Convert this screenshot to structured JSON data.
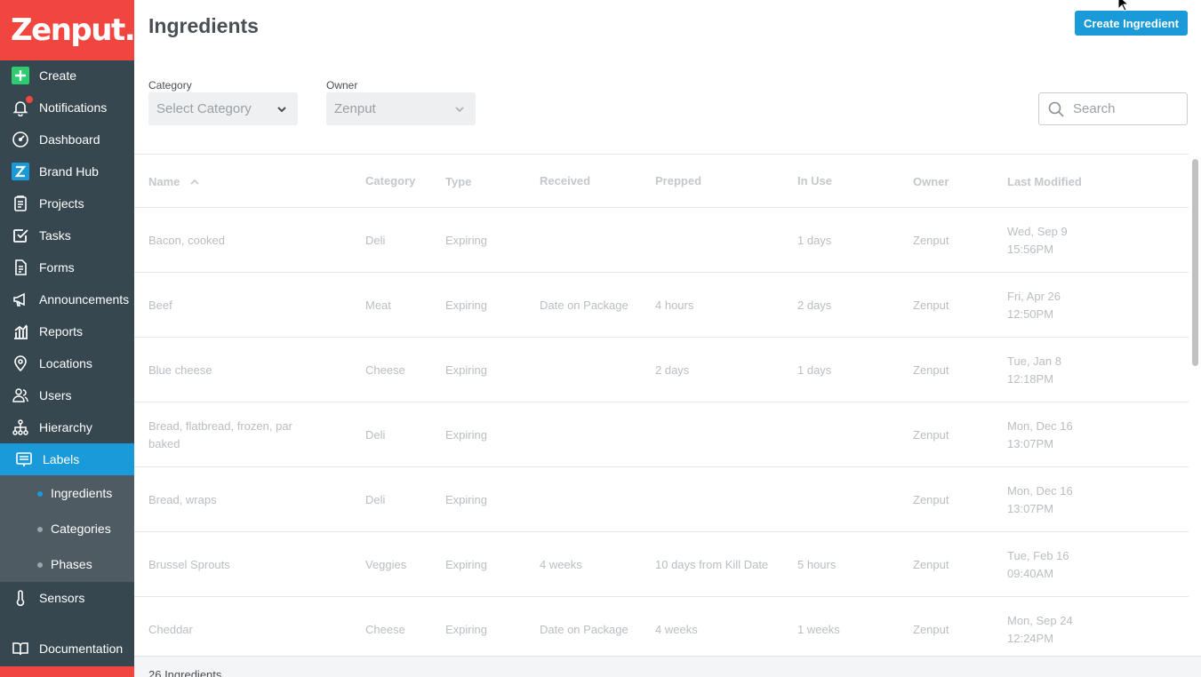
{
  "brand": {
    "logo_text": "Zenput.",
    "primary_color": "#f0463f",
    "accent_color": "#1a9ad9",
    "sidebar_color": "#37474f"
  },
  "sidebar": {
    "items": [
      {
        "label": "Create",
        "icon": "plus-square-icon"
      },
      {
        "label": "Notifications",
        "icon": "bell-icon"
      },
      {
        "label": "Dashboard",
        "icon": "speedometer-icon"
      },
      {
        "label": "Brand Hub",
        "icon": "brand-hub-z-icon"
      },
      {
        "label": "Projects",
        "icon": "clipboard-icon"
      },
      {
        "label": "Tasks",
        "icon": "checkbox-icon"
      },
      {
        "label": "Forms",
        "icon": "form-icon"
      },
      {
        "label": "Announcements",
        "icon": "megaphone-icon"
      },
      {
        "label": "Reports",
        "icon": "bar-chart-icon"
      },
      {
        "label": "Locations",
        "icon": "map-pin-icon"
      },
      {
        "label": "Users",
        "icon": "users-icon"
      },
      {
        "label": "Hierarchy",
        "icon": "hierarchy-icon"
      },
      {
        "label": "Labels",
        "icon": "label-icon"
      },
      {
        "label": "Sensors",
        "icon": "thermometer-icon"
      },
      {
        "label": "Documentation",
        "icon": "book-icon"
      }
    ],
    "sub_items": [
      {
        "label": "Ingredients"
      },
      {
        "label": "Categories"
      },
      {
        "label": "Phases"
      }
    ]
  },
  "header": {
    "title": "Ingredients",
    "create_label": "Create Ingredient"
  },
  "filters": {
    "category_label": "Category",
    "category_value": "Select Category",
    "owner_label": "Owner",
    "owner_value": "Zenput",
    "search_placeholder": "Search"
  },
  "table": {
    "columns": [
      "Name",
      "Category",
      "Type",
      "Received",
      "Prepped",
      "In Use",
      "Owner",
      "Last Modified"
    ],
    "sort_column": "Name",
    "sort_direction": "ascending",
    "rows": [
      {
        "name": "Bacon, cooked",
        "category": "Deli",
        "type": "Expiring",
        "received": "",
        "prepped": "",
        "in_use": "1 days",
        "owner": "Zenput",
        "modified_date": "Wed, Sep 9",
        "modified_time": "15:56PM"
      },
      {
        "name": "Beef",
        "category": "Meat",
        "type": "Expiring",
        "received": "Date on Package",
        "prepped": "4 hours",
        "in_use": "2 days",
        "owner": "Zenput",
        "modified_date": "Fri, Apr 26",
        "modified_time": "12:50PM"
      },
      {
        "name": "Blue cheese",
        "category": "Cheese",
        "type": "Expiring",
        "received": "",
        "prepped": "2 days",
        "in_use": "1 days",
        "owner": "Zenput",
        "modified_date": "Tue, Jan 8",
        "modified_time": "12:18PM"
      },
      {
        "name": "Bread, flatbread, frozen, par baked",
        "category": "Deli",
        "type": "Expiring",
        "received": "",
        "prepped": "",
        "in_use": "",
        "owner": "Zenput",
        "modified_date": "Mon, Dec 16",
        "modified_time": "13:07PM"
      },
      {
        "name": "Bread, wraps",
        "category": "Deli",
        "type": "Expiring",
        "received": "",
        "prepped": "",
        "in_use": "",
        "owner": "Zenput",
        "modified_date": "Mon, Dec 16",
        "modified_time": "13:07PM"
      },
      {
        "name": "Brussel Sprouts",
        "category": "Veggies",
        "type": "Expiring",
        "received": "4 weeks",
        "prepped": "10 days from Kill Date",
        "in_use": "5 hours",
        "owner": "Zenput",
        "modified_date": "Tue, Feb 16",
        "modified_time": "09:40AM"
      },
      {
        "name": "Cheddar",
        "category": "Cheese",
        "type": "Expiring",
        "received": "Date on Package",
        "prepped": "4 weeks",
        "in_use": "1 weeks",
        "owner": "Zenput",
        "modified_date": "Mon, Sep 24",
        "modified_time": "12:24PM"
      }
    ]
  },
  "footer": {
    "count_text": "26 Ingredients"
  }
}
